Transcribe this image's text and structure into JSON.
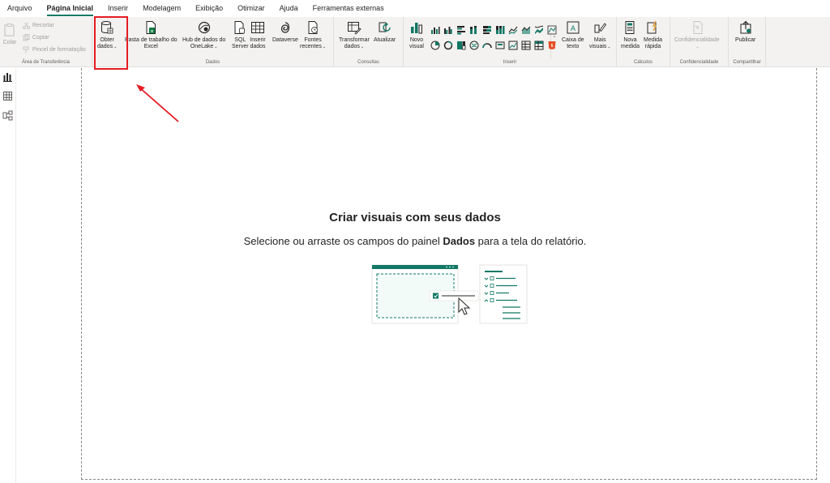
{
  "menu": {
    "tabs": [
      {
        "label": "Arquivo",
        "active": false
      },
      {
        "label": "Página Inicial",
        "active": true
      },
      {
        "label": "Inserir",
        "active": false
      },
      {
        "label": "Modelagem",
        "active": false
      },
      {
        "label": "Exibição",
        "active": false
      },
      {
        "label": "Otimizar",
        "active": false
      },
      {
        "label": "Ajuda",
        "active": false
      },
      {
        "label": "Ferramentas externas",
        "active": false
      }
    ]
  },
  "ribbon": {
    "clipboard": {
      "colar": "Colar",
      "recortar": "Recortar",
      "copiar": "Copiar",
      "pincel": "Pincel de formatação",
      "label": "Área de Transferência"
    },
    "dados": {
      "obter_1": "Obter",
      "obter_2": "dados",
      "excel_1": "Pasta de trabalho do",
      "excel_2": "Excel",
      "onelake_1": "Hub de dados do",
      "onelake_2": "OneLake",
      "sql_1": "SQL",
      "sql_2": "Server",
      "inserir_1": "Inserir",
      "inserir_2": "dados",
      "dataverse": "Dataverse",
      "fontes_1": "Fontes",
      "fontes_2": "recentes",
      "label": "Dados"
    },
    "consultas": {
      "transformar_1": "Transformar",
      "transformar_2": "dados",
      "atualizar": "Atualizar",
      "label": "Consultas"
    },
    "inserir": {
      "novo_1": "Novo",
      "novo_2": "visual",
      "caixa_1": "Caixa de",
      "caixa_2": "texto",
      "mais_1": "Mais",
      "mais_2": "visuais",
      "label": "Inserir"
    },
    "calculos": {
      "nova_1": "Nova",
      "nova_2": "medida",
      "rapida_1": "Medida",
      "rapida_2": "rápida",
      "label": "Cálculos"
    },
    "confidencialidade": {
      "btn": "Confidencialidade",
      "label": "Confidencialidade"
    },
    "compartilhar": {
      "publicar": "Publicar",
      "label": "Compartilhar"
    }
  },
  "canvas": {
    "title": "Criar visuais com seus dados",
    "subtitle_before": "Selecione ou arraste os campos do painel ",
    "subtitle_bold": "Dados",
    "subtitle_after": " para a tela do relatório."
  },
  "colors": {
    "accent": "#117865",
    "highlight": "#e51c23"
  },
  "icons": {
    "left_rail": [
      "report-view-icon",
      "table-view-icon",
      "model-view-icon"
    ]
  }
}
